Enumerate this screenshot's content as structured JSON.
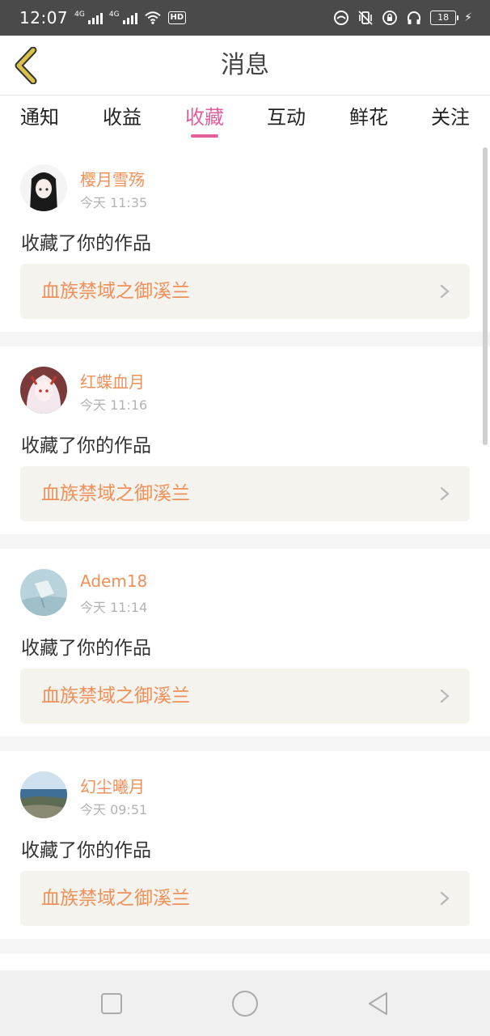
{
  "status_bar": {
    "time": "12:07",
    "sim1_label": "4G",
    "sim2_label": "4G",
    "hd_label": "HD",
    "battery_level": "18",
    "icons": [
      "signal-icon",
      "wifi-icon",
      "hd-icon",
      "vibrate-icon",
      "lock-rotation-icon",
      "headphones-icon",
      "battery-icon",
      "charging-icon"
    ]
  },
  "header": {
    "title": "消息",
    "back_icon": "chevron-left-icon",
    "accent_color": "#d8c24a"
  },
  "tabs": {
    "items": [
      "通知",
      "收益",
      "收藏",
      "互动",
      "鲜花",
      "关注"
    ],
    "active_index": 2,
    "active_label": "收藏",
    "active_color": "#e15f9b"
  },
  "messages": [
    {
      "username": "樱月雪殇",
      "time": "今天 11:35",
      "action": "收藏了你的作品",
      "work_title": "血族禁域之御溪兰"
    },
    {
      "username": "红蝶血月",
      "time": "今天 11:16",
      "action": "收藏了你的作品",
      "work_title": "血族禁域之御溪兰"
    },
    {
      "username": "Adem18",
      "time": "今天 11:14",
      "action": "收藏了你的作品",
      "work_title": "血族禁域之御溪兰"
    },
    {
      "username": "幻尘曦月",
      "time": "今天 09:51",
      "action": "收藏了你的作品",
      "work_title": "血族禁域之御溪兰"
    }
  ],
  "colors": {
    "username": "#f0905a",
    "work_title": "#f0905a",
    "work_bg": "#f4f3ed"
  },
  "nav_bar": {
    "icons": [
      "recents-square-icon",
      "home-circle-icon",
      "back-triangle-icon"
    ]
  }
}
